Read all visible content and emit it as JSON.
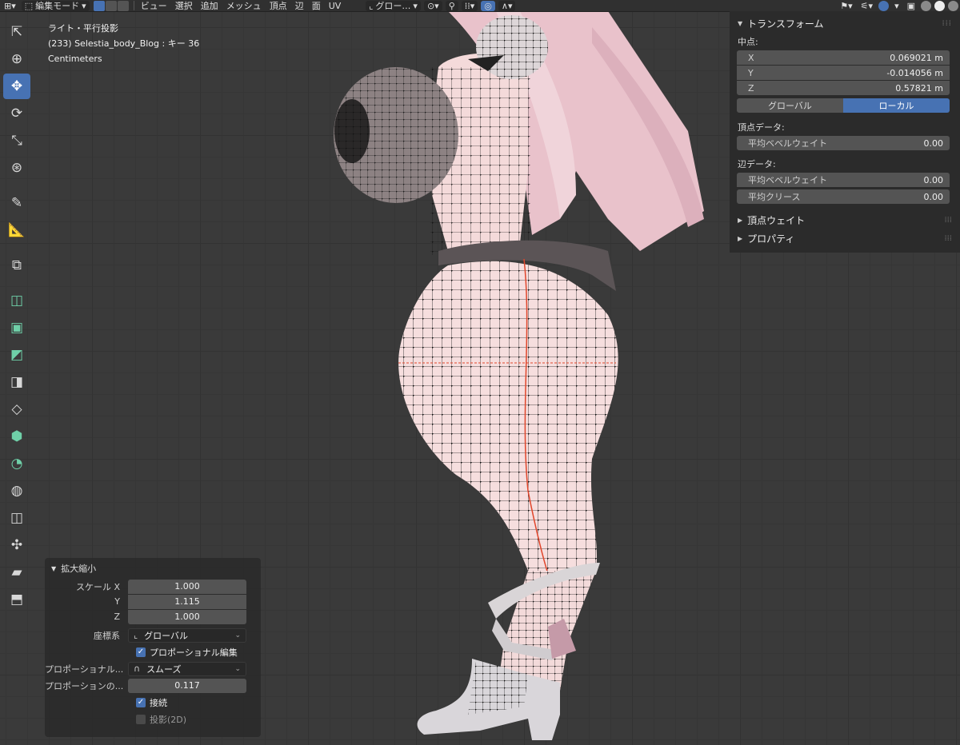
{
  "header": {
    "mode_label": "編集モード",
    "menus": [
      "ビュー",
      "選択",
      "追加",
      "メッシュ",
      "頂点",
      "辺",
      "面",
      "UV"
    ],
    "transform_orientation": "グロー…"
  },
  "viewport_info": {
    "view": "ライト・平行投影",
    "object": "(233) Selestia_body_Blog : キー 36",
    "units": "Centimeters"
  },
  "toolbar": {
    "tools": [
      {
        "icon": "select-cursor-icon",
        "active": false
      },
      {
        "icon": "3d-cursor-icon",
        "active": false
      },
      {
        "icon": "move-icon",
        "active": true
      },
      {
        "icon": "rotate-icon",
        "active": false
      },
      {
        "icon": "scale-icon",
        "active": false
      },
      {
        "icon": "transform-icon",
        "active": false
      },
      {
        "icon": "annotate-icon",
        "active": false
      },
      {
        "icon": "measure-icon",
        "active": false
      },
      {
        "icon": "add-cube-icon",
        "active": false
      },
      {
        "icon": "extrude-icon",
        "active": false
      },
      {
        "icon": "inset-icon",
        "active": false
      },
      {
        "icon": "bevel-icon",
        "active": false
      },
      {
        "icon": "loop-cut-icon",
        "active": false
      },
      {
        "icon": "knife-icon",
        "active": false
      },
      {
        "icon": "poly-build-icon",
        "active": false
      },
      {
        "icon": "spin-icon",
        "active": false
      },
      {
        "icon": "smooth-icon",
        "active": false
      },
      {
        "icon": "edge-slide-icon",
        "active": false
      },
      {
        "icon": "shrink-fatten-icon",
        "active": false
      },
      {
        "icon": "shear-icon",
        "active": false
      },
      {
        "icon": "rip-icon",
        "active": false
      }
    ]
  },
  "npanel": {
    "transform_title": "トランスフォーム",
    "median_label": "中点:",
    "x_label": "X",
    "x_value": "0.069021 m",
    "y_label": "Y",
    "y_value": "-0.014056 m",
    "z_label": "Z",
    "z_value": "0.57821 m",
    "global_label": "グローバル",
    "local_label": "ローカル",
    "vertex_data_label": "頂点データ:",
    "vertex_bevel_label": "平均ベベルウェイト",
    "vertex_bevel_value": "0.00",
    "edge_data_label": "辺データ:",
    "edge_bevel_label": "平均ベベルウェイト",
    "edge_bevel_value": "0.00",
    "crease_label": "平均クリース",
    "crease_value": "0.00",
    "vertex_weights_label": "頂点ウェイト",
    "properties_label": "プロパティ"
  },
  "operator": {
    "title": "拡大縮小",
    "scale_x_label": "スケール X",
    "scale_x": "1.000",
    "scale_y_label": "Y",
    "scale_y": "1.115",
    "scale_z_label": "Z",
    "scale_z": "1.000",
    "orientation_label": "座標系",
    "orientation_value": "グローバル",
    "proportional_edit_label": "プロポーショナル編集",
    "proportional_edit_checked": true,
    "falloff_label": "プロポーショナル...",
    "falloff_value": "スムーズ",
    "size_label": "プロポーションの...",
    "size_value": "0.117",
    "connected_label": "接続",
    "connected_checked": true,
    "projected_label": "投影(2D)",
    "projected_checked": false
  },
  "colors": {
    "accent": "#4772b3",
    "mesh_skin": "#f6dede",
    "hair": "#e9c2cb",
    "seam": "#e0452a"
  }
}
